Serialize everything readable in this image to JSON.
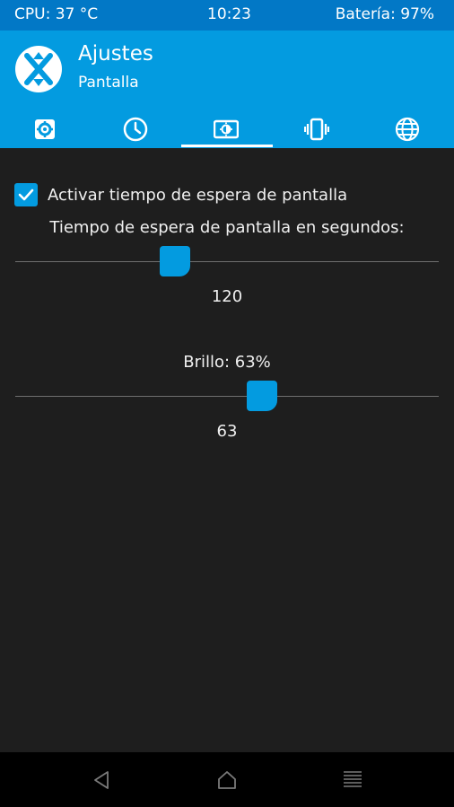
{
  "status_bar": {
    "cpu": "CPU: 37 °C",
    "time": "10:23",
    "battery": "Batería: 97%"
  },
  "header": {
    "title": "Ajustes",
    "subtitle": "Pantalla"
  },
  "tabs": [
    {
      "icon": "gear-icon",
      "selected": false
    },
    {
      "icon": "clock-icon",
      "selected": false
    },
    {
      "icon": "screen-brightness-icon",
      "selected": true
    },
    {
      "icon": "vibration-icon",
      "selected": false
    },
    {
      "icon": "globe-icon",
      "selected": false
    }
  ],
  "screen_timeout": {
    "checkbox_label": "Activar tiempo de espera de pantalla",
    "checked": true,
    "label": "Tiempo de espera de pantalla en segundos:",
    "value": "120"
  },
  "brightness": {
    "label": "Brillo: 63%",
    "value": "63"
  },
  "colors": {
    "accent": "#039be0",
    "status_bar": "#0278c6",
    "background": "#1e1e1e"
  }
}
